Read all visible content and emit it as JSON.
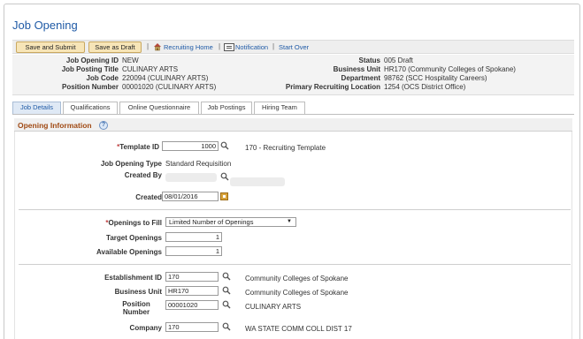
{
  "page": {
    "title": "Job Opening"
  },
  "toolbar": {
    "save_submit": "Save and Submit",
    "save_draft": "Save as Draft",
    "recruiting_home": "Recruiting Home",
    "notification": "Notification",
    "start_over": "Start Over"
  },
  "summary": {
    "left": [
      {
        "label": "Job Opening ID",
        "value": "NEW"
      },
      {
        "label": "Job Posting Title",
        "value": "CULINARY ARTS"
      },
      {
        "label": "Job Code",
        "value": "220094 (CULINARY ARTS)"
      },
      {
        "label": "Position Number",
        "value": "00001020 (CULINARY ARTS)"
      }
    ],
    "right": [
      {
        "label": "Status",
        "value": "005 Draft"
      },
      {
        "label": "Business Unit",
        "value": "HR170 (Community Colleges of Spokane)"
      },
      {
        "label": "Department",
        "value": "98762 (SCC Hospitality Careers)"
      },
      {
        "label": "Primary Recruiting Location",
        "value": "1254 (OCS District Office)"
      }
    ]
  },
  "tabs": [
    "Job Details",
    "Qualifications",
    "Online Questionnaire",
    "Job Postings",
    "Hiring Team"
  ],
  "section": {
    "title": "Opening Information",
    "help": "?"
  },
  "fields": {
    "template_id": {
      "label": "Template ID",
      "value": "1000",
      "desc": "170 - Recruiting Template"
    },
    "job_opening_type": {
      "label": "Job Opening Type",
      "value": "Standard Requisition"
    },
    "created_by": {
      "label": "Created By"
    },
    "created": {
      "label": "Created",
      "value": "08/01/2016"
    },
    "openings_to_fill": {
      "label": "Openings to Fill",
      "value": "Limited Number of Openings"
    },
    "target_openings": {
      "label": "Target Openings",
      "value": "1"
    },
    "available_openings": {
      "label": "Available Openings",
      "value": "1"
    },
    "establishment_id": {
      "label": "Establishment ID",
      "value": "170",
      "desc": "Community Colleges of Spokane"
    },
    "business_unit": {
      "label": "Business Unit",
      "value": "HR170",
      "desc": "Community Colleges of Spokane"
    },
    "position_number": {
      "label": "Position Number",
      "value": "00001020",
      "desc": "CULINARY ARTS"
    },
    "company": {
      "label": "Company",
      "value": "170",
      "desc": "WA STATE COMM COLL DIST 17"
    }
  },
  "colors": {
    "link": "#1f5aa6",
    "section_title": "#a04a14",
    "button_bg": "#f7e5b7"
  }
}
